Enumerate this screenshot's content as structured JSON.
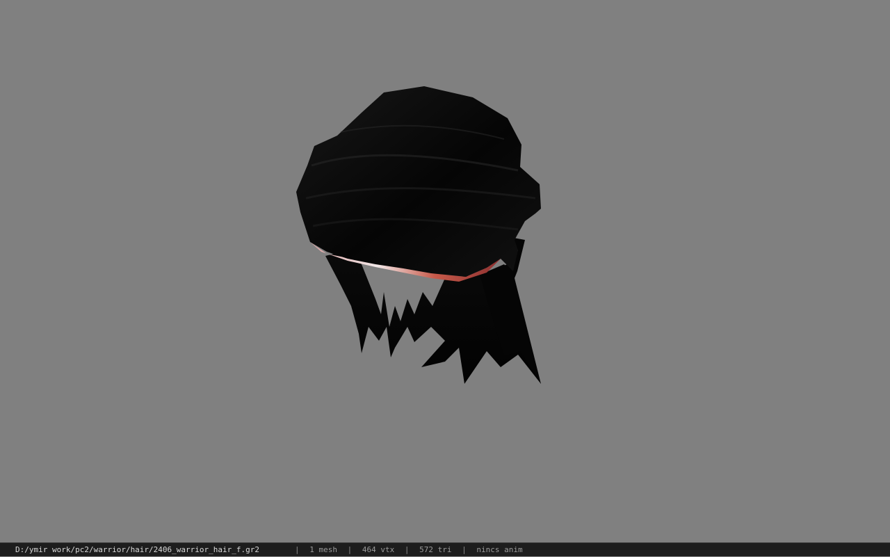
{
  "viewer": {
    "background_color": "#808080",
    "model_icon": "hair-mesh-icon"
  },
  "status": {
    "file_path": "D:/ymir work/pc2/warrior/hair/2406_warrior_hair_f.gr2",
    "separator": "|",
    "mesh_count": "1 mesh",
    "vertex_count": "464 vtx",
    "triangle_count": "572 tri",
    "animation": "nincs anim"
  }
}
